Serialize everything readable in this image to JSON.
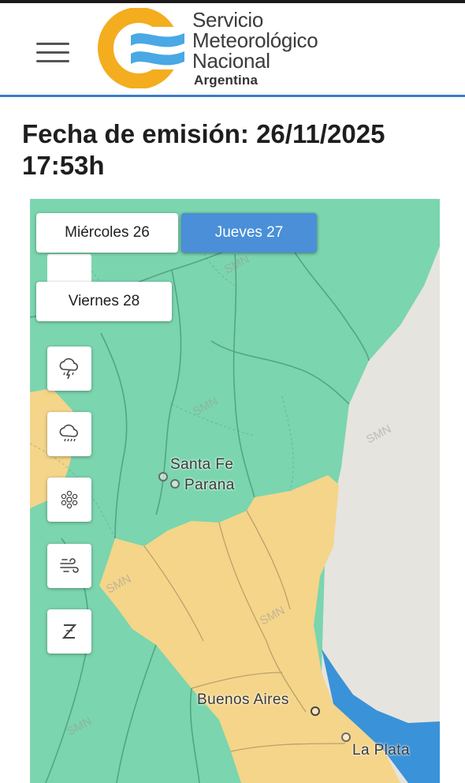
{
  "header": {
    "brand_line1": "Servicio",
    "brand_line2": "Meteorológico",
    "brand_line3": "Nacional",
    "brand_sub": "Argentina"
  },
  "emission": {
    "label": "Fecha de emisión: 26/11/2025 17:53h"
  },
  "days": [
    {
      "label": "Miércoles 26",
      "active": false
    },
    {
      "label": "Jueves 27",
      "active": true
    },
    {
      "label": "Viernes 28",
      "active": false
    }
  ],
  "layers": [
    {
      "name": "thunderstorm-icon"
    },
    {
      "name": "rain-icon"
    },
    {
      "name": "snow-icon"
    },
    {
      "name": "wind-icon"
    },
    {
      "name": "sleep-icon"
    }
  ],
  "map": {
    "cities": [
      "Santa Fe",
      "Parana",
      "Buenos Aires",
      "La Plata"
    ],
    "watermark": "SMN",
    "colors": {
      "green": "#7bd5ae",
      "yellow": "#f4d58a",
      "land": "#e6e4df",
      "water": "#3a92d8",
      "accent": "#4a8fd8"
    }
  }
}
